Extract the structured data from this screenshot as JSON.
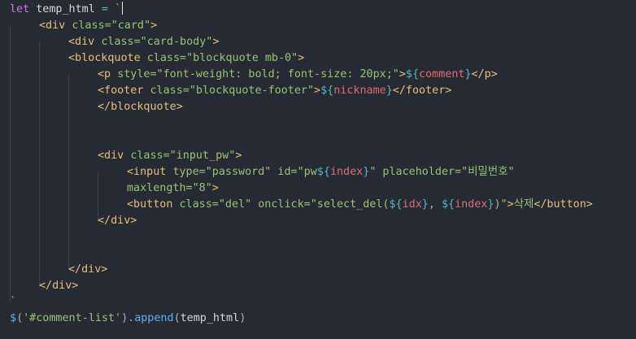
{
  "code": {
    "lines": [
      {
        "indent": 0,
        "tokens": [
          {
            "t": "let",
            "c": "kw"
          },
          {
            "t": " ",
            "c": "id"
          },
          {
            "t": "temp_html",
            "c": "id"
          },
          {
            "t": " = ",
            "c": "op"
          },
          {
            "t": "`",
            "c": "str"
          }
        ],
        "caret": true
      },
      {
        "indent": 1,
        "tokens": [
          {
            "t": "<div ",
            "c": "tag"
          },
          {
            "t": "class=\"card\"",
            "c": "str"
          },
          {
            "t": ">",
            "c": "tag"
          }
        ]
      },
      {
        "indent": 2,
        "tokens": [
          {
            "t": "<div ",
            "c": "tag"
          },
          {
            "t": "class=\"card-body\"",
            "c": "str"
          },
          {
            "t": ">",
            "c": "tag"
          }
        ]
      },
      {
        "indent": 2,
        "tokens": [
          {
            "t": "<blockquote ",
            "c": "tag"
          },
          {
            "t": "class=\"blockquote mb-0\"",
            "c": "str"
          },
          {
            "t": ">",
            "c": "tag"
          }
        ]
      },
      {
        "indent": 3,
        "tokens": [
          {
            "t": "<p ",
            "c": "tag"
          },
          {
            "t": "style=\"font-weight: bold; font-size: 20px;\"",
            "c": "str"
          },
          {
            "t": ">",
            "c": "tag"
          },
          {
            "t": "${",
            "c": "interp"
          },
          {
            "t": "comment",
            "c": "var"
          },
          {
            "t": "}",
            "c": "interp"
          },
          {
            "t": "</p>",
            "c": "tag"
          }
        ]
      },
      {
        "indent": 3,
        "tokens": [
          {
            "t": "<footer ",
            "c": "tag"
          },
          {
            "t": "class=\"blockquote-footer\"",
            "c": "str"
          },
          {
            "t": ">",
            "c": "tag"
          },
          {
            "t": "${",
            "c": "interp"
          },
          {
            "t": "nickname",
            "c": "var"
          },
          {
            "t": "}",
            "c": "interp"
          },
          {
            "t": "</footer>",
            "c": "tag"
          }
        ]
      },
      {
        "indent": 3,
        "tokens": [
          {
            "t": "</blockquote>",
            "c": "tag"
          }
        ]
      },
      {
        "indent": 0,
        "tokens": []
      },
      {
        "indent": 0,
        "tokens": []
      },
      {
        "indent": 3,
        "tokens": [
          {
            "t": "<div ",
            "c": "tag"
          },
          {
            "t": "class=\"input_pw\"",
            "c": "str"
          },
          {
            "t": ">",
            "c": "tag"
          }
        ]
      },
      {
        "indent": 4,
        "tokens": [
          {
            "t": "<input ",
            "c": "tag"
          },
          {
            "t": "type=\"password\" id=\"pw",
            "c": "str"
          },
          {
            "t": "${",
            "c": "interp"
          },
          {
            "t": "index",
            "c": "var"
          },
          {
            "t": "}",
            "c": "interp"
          },
          {
            "t": "\" placeholder=\"비밀번호\"",
            "c": "str"
          }
        ]
      },
      {
        "indent": 4,
        "tokens": [
          {
            "t": "maxlength=\"8\"",
            "c": "str"
          },
          {
            "t": ">",
            "c": "tag"
          }
        ]
      },
      {
        "indent": 4,
        "tokens": [
          {
            "t": "<button ",
            "c": "tag"
          },
          {
            "t": "class=\"del\" onclick=\"select_del(",
            "c": "str"
          },
          {
            "t": "${",
            "c": "interp"
          },
          {
            "t": "idx",
            "c": "var"
          },
          {
            "t": "}",
            "c": "interp"
          },
          {
            "t": ", ",
            "c": "str"
          },
          {
            "t": "${",
            "c": "interp"
          },
          {
            "t": "index",
            "c": "var"
          },
          {
            "t": "}",
            "c": "interp"
          },
          {
            "t": ")\"",
            "c": "str"
          },
          {
            "t": ">",
            "c": "tag"
          },
          {
            "t": "삭제",
            "c": "str"
          },
          {
            "t": "</button>",
            "c": "tag"
          }
        ]
      },
      {
        "indent": 3,
        "tokens": [
          {
            "t": "</div>",
            "c": "tag"
          }
        ]
      },
      {
        "indent": 0,
        "tokens": []
      },
      {
        "indent": 0,
        "tokens": []
      },
      {
        "indent": 2,
        "tokens": [
          {
            "t": "</div>",
            "c": "tag"
          }
        ]
      },
      {
        "indent": 1,
        "tokens": [
          {
            "t": "</div>",
            "c": "tag"
          }
        ]
      },
      {
        "indent": 0,
        "tokens": [
          {
            "t": "`",
            "c": "str"
          }
        ]
      },
      {
        "indent": 0,
        "tokens": [
          {
            "t": "$",
            "c": "fn"
          },
          {
            "t": "(",
            "c": "punc"
          },
          {
            "t": "'#comment-list'",
            "c": "str"
          },
          {
            "t": ").",
            "c": "punc"
          },
          {
            "t": "append",
            "c": "fn"
          },
          {
            "t": "(",
            "c": "punc"
          },
          {
            "t": "temp_html",
            "c": "id"
          },
          {
            "t": ")",
            "c": "punc"
          }
        ]
      }
    ]
  },
  "colors": {
    "background": "#262a33",
    "keyword": "#c678dd",
    "tag": "#e5c07b",
    "string": "#98c379",
    "interpolation": "#56b6c2",
    "variable": "#e06c75",
    "function": "#61afef"
  }
}
